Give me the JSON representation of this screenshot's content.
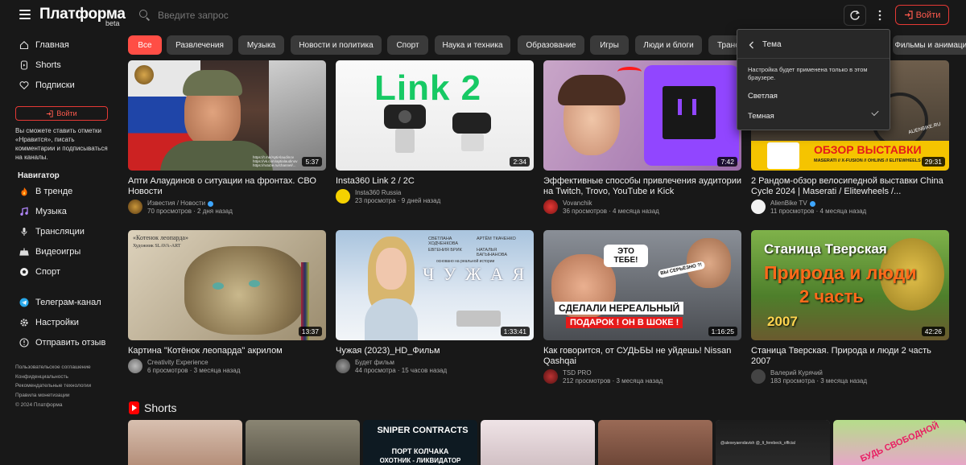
{
  "header": {
    "logo": "Платформа",
    "logo_badge": "beta",
    "search_placeholder": "Введите запрос",
    "login_label": "Войти"
  },
  "sidebar": {
    "nav": [
      {
        "label": "Главная",
        "icon": "home-icon"
      },
      {
        "label": "Shorts",
        "icon": "shorts-icon"
      },
      {
        "label": "Подписки",
        "icon": "heart-icon"
      }
    ],
    "login_label": "Войти",
    "note": "Вы сможете ставить отметки «Нравится», писать комментарии и подписываться на каналы.",
    "navigator_heading": "Навигатор",
    "navigator": [
      {
        "label": "В тренде",
        "icon": "fire-icon"
      },
      {
        "label": "Музыка",
        "icon": "music-icon"
      },
      {
        "label": "Трансляции",
        "icon": "broadcast-icon"
      },
      {
        "label": "Видеоигры",
        "icon": "gamepad-icon"
      },
      {
        "label": "Спорт",
        "icon": "ball-icon"
      }
    ],
    "extra": [
      {
        "label": "Телеграм-канал",
        "icon": "telegram-icon"
      },
      {
        "label": "Настройки",
        "icon": "gear-icon"
      },
      {
        "label": "Отправить отзыв",
        "icon": "feedback-icon"
      }
    ],
    "footer_links": [
      "Пользовательское соглашение",
      "Конфиденциальность",
      "Рекомендательные технологии",
      "Правила монетизации"
    ],
    "copyright": "© 2024 Платформа"
  },
  "chips": [
    "Все",
    "Развлечения",
    "Музыка",
    "Новости и политика",
    "Спорт",
    "Наука и техника",
    "Образование",
    "Игры",
    "Люди и блоги",
    "Транспорт",
    "Фильмы и анимация"
  ],
  "videos": [
    {
      "title": "Апти Алаудинов о ситуации на фронтах. СВО Новости",
      "channel": "Известия / Новости",
      "verified": true,
      "views": "70 просмотров",
      "age": "2 дня назад",
      "duration": "5:37"
    },
    {
      "title": "Insta360 Link 2 / 2C",
      "channel": "Insta360 Russia",
      "verified": false,
      "views": "23 просмотра",
      "age": "9 дней назад",
      "duration": "2:34"
    },
    {
      "title": "Эффективные способы привлечения аудитории на Twitch, Trovo, YouTube и Kick",
      "channel": "Vovanchik",
      "verified": false,
      "views": "36 просмотров",
      "age": "4 месяца назад",
      "duration": "7:42"
    },
    {
      "title": "2 Рандом-обзор велосипедной выставки China Cycle 2024 | Maserati / Elitewheels /...",
      "channel": "AlienBike TV",
      "verified": true,
      "views": "11 просмотров",
      "age": "4 месяца назад",
      "duration": "29:31"
    },
    {
      "title": "Картина \"Котёнок леопарда\" акрилом",
      "channel": "Creativity Experience",
      "verified": false,
      "views": "6 просмотров",
      "age": "3 месяца назад",
      "duration": "13:37"
    },
    {
      "title": "Чужая (2023)_HD_Фильм",
      "channel": "Будет фильм",
      "verified": false,
      "views": "44 просмотра",
      "age": "15 часов назад",
      "duration": "1:33:41"
    },
    {
      "title": "Как говорится, от СУДЬБЫ не уйдешь! Nissan Qashqai",
      "channel": "TSD PRO",
      "verified": false,
      "views": "212 просмотров",
      "age": "3 месяца назад",
      "duration": "1:16:25"
    },
    {
      "title": "Станица Тверская. Природа и люди 2 часть 2007",
      "channel": "Валерий Курячий",
      "verified": false,
      "views": "183 просмотра",
      "age": "3 месяца назад",
      "duration": "42:26"
    }
  ],
  "thumb_text": {
    "link2": "Link 2",
    "kitten_caption": "«Котенок леопарда»",
    "kitten_author": "Художник SLAVA-ART",
    "chuzhaya": "Ч У Ж А Я",
    "chuzhaya_sub": "основано на реальной истории",
    "actor1": "СВЕТЛАНА ХОДЧЕНКОВА",
    "actor2": "АРТЁМ ТКАЧЕНКО",
    "actor3": "ЕВГЕНИЯ БРИК",
    "actor4": "НАТАЛЬЯ БАГЫНАНОВА",
    "car_this": "ЭТО ТЕБЕ!",
    "car_serious": "ВЫ СЕРЬЁЗНО ?!",
    "car_line1": "СДЕЛАЛИ НЕРЕАЛЬНЫЙ",
    "car_line2": "ПОДАРОК ! ОН В ШОКЕ !",
    "stanitsa_title": "Станица Тверская",
    "stanitsa_line1": "Природа и люди",
    "stanitsa_line2": "2 часть",
    "stanitsa_year": "2007",
    "expo_title": "ОБЗОР ВЫСТАВКИ",
    "expo_sub": "MASERATI // X-FUSION // OHLINS // ELITEWHEELS",
    "expo_brand": "ALIENBIKE.RU",
    "news_url1": "https://t.me/AptiAlaudinov",
    "news_url2": "https://vk.com/aptialaudinov",
    "news_url3": "https://rutube.ru/channel/..."
  },
  "theme_menu": {
    "title": "Тема",
    "note": "Настройка будет применена только в этом браузере.",
    "options": [
      "Светлая",
      "Темная"
    ],
    "selected": "Темная"
  },
  "shorts": {
    "heading": "Shorts",
    "items": [
      {
        "text": ""
      },
      {
        "text": ""
      },
      {
        "text": "SNIPER CONTRACTS",
        "sub": "ПОРТ КОЛЧАКА",
        "sub2": "ОХОТНИК - ЛИКВИДАТОР"
      },
      {
        "text": ""
      },
      {
        "text": ""
      },
      {
        "text": ""
      },
      {
        "text": "@alexeyaendavish   @_lt_ferebeck_official"
      },
      {
        "text": "БУДЬ СВОБОДНОЙ"
      }
    ]
  },
  "colors": {
    "accent": "#ff4e45",
    "background": "#181818",
    "chip": "#3a3a3a"
  }
}
